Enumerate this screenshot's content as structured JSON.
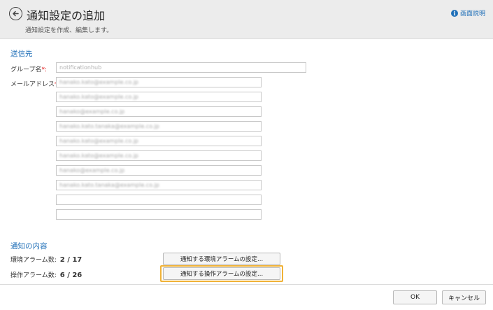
{
  "header": {
    "title": "通知設定の追加",
    "subtitle": "通知設定を作成、編集します。",
    "help_label": "画面説明",
    "help_icon": "i"
  },
  "recipients": {
    "section_title": "送信先",
    "group_label": "グループ名",
    "group_value": "notificationhub",
    "email_label": "メールアドレス",
    "required_mark": "*:",
    "emails": [
      "hanako.kato@example.co.jp",
      "hanako.kato@example.co.jp",
      "hanako@example.co.jp",
      "hanako.kato.tanaka@example.co.jp",
      "hanako.kato@example.co.jp",
      "hanako.kato@example.co.jp",
      "hanako@example.co.jp",
      "hanako.kato.tanaka@example.co.jp",
      "",
      ""
    ]
  },
  "notification": {
    "section_title": "通知の内容",
    "env_alarm_label": "環境アラーム数:",
    "env_alarm_value": "2 / 17",
    "op_alarm_label": "操作アラーム数:",
    "op_alarm_value": "6 / 26",
    "env_button": "通知する環境アラームの設定...",
    "op_button": "通知する操作アラームの設定..."
  },
  "footer": {
    "ok": "OK",
    "cancel": "キャンセル"
  },
  "colors": {
    "accent": "#1f6fb8",
    "highlight": "#f0b237",
    "required": "#dd0000"
  }
}
